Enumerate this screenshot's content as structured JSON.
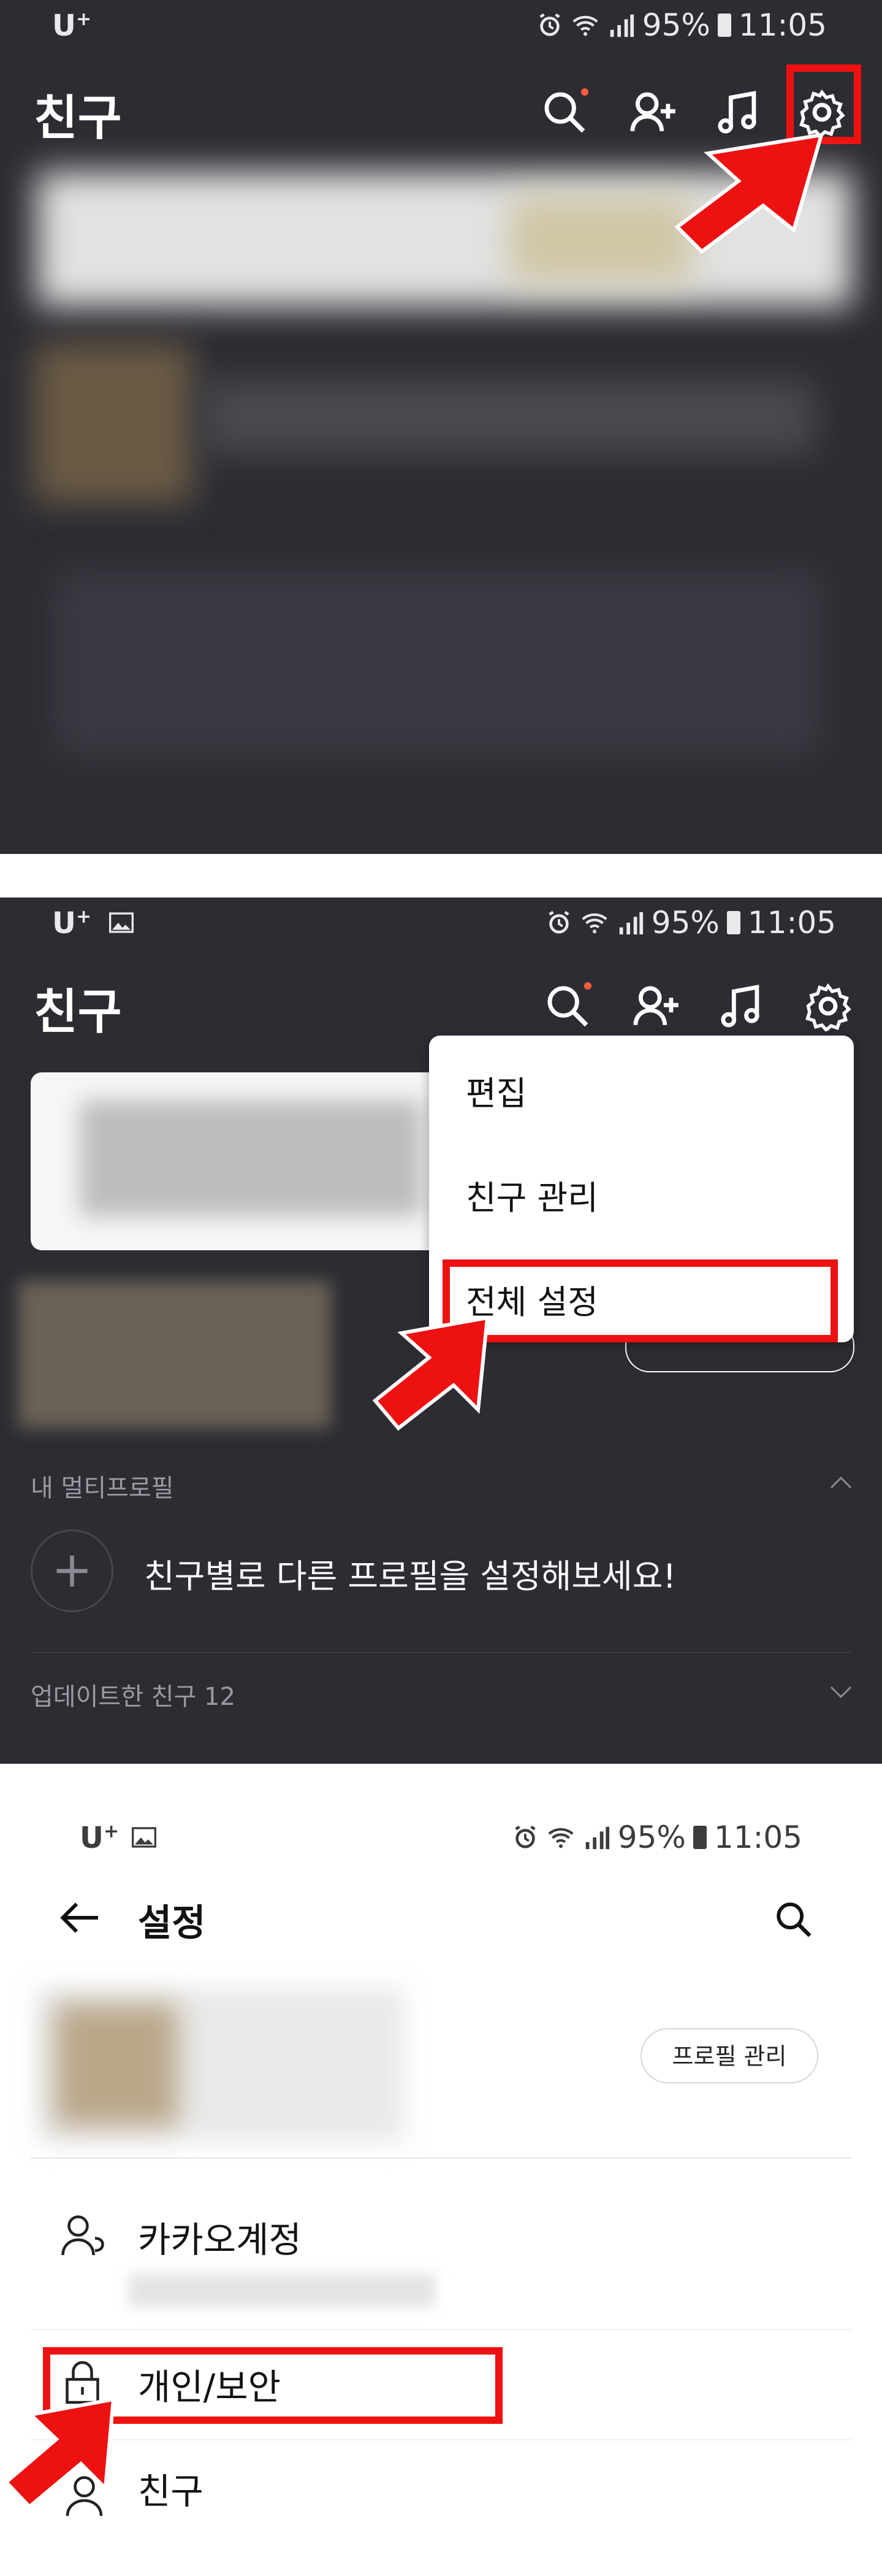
{
  "panel1": {
    "status": {
      "carrier": "U",
      "carrier_sup": "+",
      "battery": "95%",
      "time": "11:05"
    },
    "header": {
      "title": "친구"
    },
    "icons": [
      "search-icon",
      "add-friend-icon",
      "music-icon",
      "settings-gear-icon"
    ]
  },
  "panel2": {
    "status": {
      "carrier": "U",
      "carrier_sup": "+",
      "battery": "95%",
      "time": "11:05"
    },
    "header": {
      "title": "친구"
    },
    "menu": {
      "items": [
        "편집",
        "친구 관리",
        "전체 설정"
      ]
    },
    "multiprofile": {
      "section_label": "내 멀티프로필",
      "add_text": "친구별로 다른 프로필을 설정해보세요!"
    },
    "updated_friends": {
      "label": "업데이트한 친구 12"
    }
  },
  "panel3": {
    "status": {
      "carrier": "U",
      "carrier_sup": "+",
      "battery": "95%",
      "time": "11:05"
    },
    "header": {
      "title": "설정"
    },
    "profile_button": "프로필 관리",
    "rows": [
      "카카오계정",
      "개인/보안",
      "친구"
    ]
  },
  "colors": {
    "dark_bg": "#2c2c33",
    "highlight": "#ee1111",
    "notify_dot": "#ff5a3c"
  }
}
